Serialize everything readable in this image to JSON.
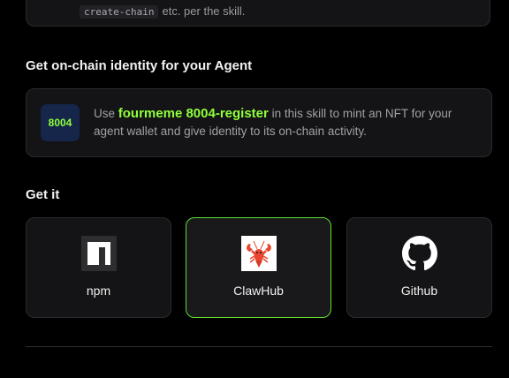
{
  "top_card": {
    "code": "create-chain",
    "text": "etc. per the skill."
  },
  "identity_section": {
    "title": "Get on-chain identity for your Agent",
    "badge": "8004",
    "text_prefix": "Use ",
    "highlight": "fourmeme 8004-register",
    "text_suffix": " in this skill to mint an NFT for your agent wallet and give identity to its on-chain activity."
  },
  "get_section": {
    "title": "Get it",
    "options": [
      {
        "label": "npm",
        "icon": "npm-icon",
        "selected": false
      },
      {
        "label": "ClawHub",
        "icon": "lobster-icon",
        "selected": true
      },
      {
        "label": "Github",
        "icon": "github-icon",
        "selected": false
      }
    ]
  },
  "colors": {
    "accent": "#8fff3a",
    "active_border": "#5de02f",
    "card_bg": "#141416",
    "page_bg": "#000000"
  }
}
